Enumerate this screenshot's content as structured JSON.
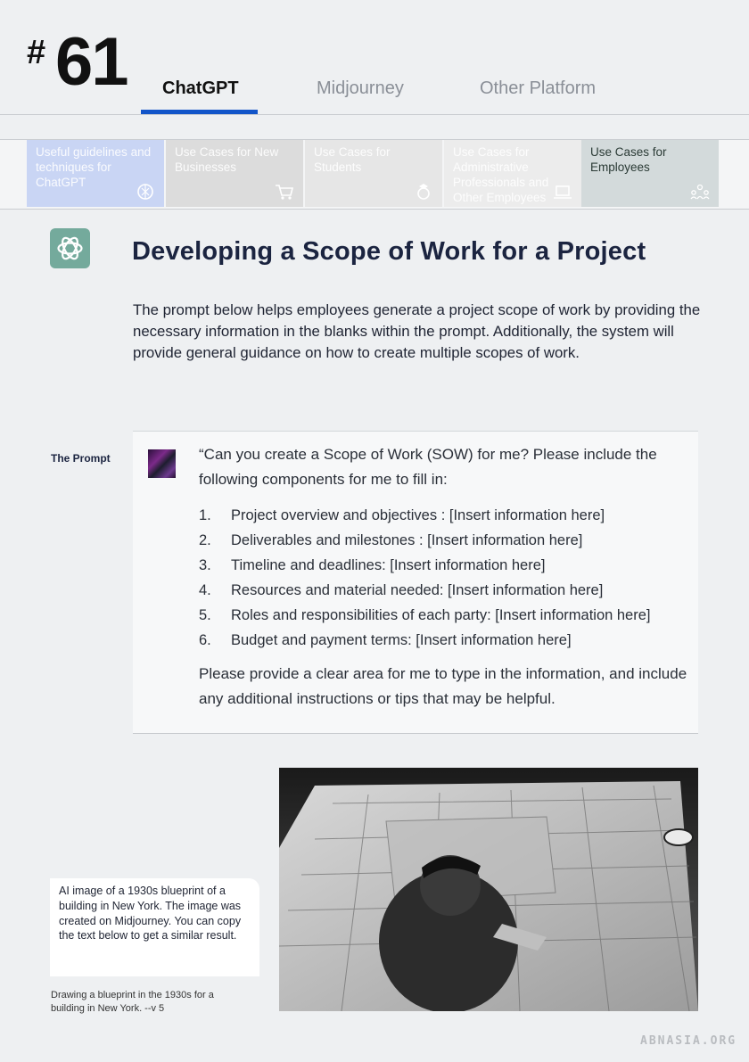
{
  "header": {
    "hash": "#",
    "number": "61",
    "tabs": [
      {
        "label": "ChatGPT",
        "active": true
      },
      {
        "label": "Midjourney",
        "active": false
      },
      {
        "label": "Other Platform",
        "active": false
      }
    ]
  },
  "categories": [
    {
      "label": "Useful guidelines and techniques for ChatGPT",
      "icon": "chatgpt-logo-icon",
      "color": "#c9d5f4"
    },
    {
      "label": "Use Cases for New Businesses",
      "icon": "cart-icon",
      "color": "#dcdcdc"
    },
    {
      "label": "Use Cases for Students",
      "icon": "student-icon",
      "color": "#e6e6e6"
    },
    {
      "label": "Use Cases for Administrative Professionals and Other Employees",
      "icon": "laptop-icon",
      "color": "#ececec"
    },
    {
      "label": "Use Cases for Employees",
      "icon": "team-icon",
      "color": "#d3dadb",
      "active": true
    }
  ],
  "section": {
    "title": "Developing a Scope of Work for a Project",
    "intro": "The prompt below helps employees generate a project scope of work by providing the necessary information in the blanks within the prompt. Additionally, the system will provide general guidance on how to create multiple scopes of work."
  },
  "prompt": {
    "label": "The Prompt",
    "intro": "“Can you create a Scope of Work (SOW) for me? Please include the following components for me to fill in:",
    "items": [
      {
        "n": "1.",
        "text": "Project overview and objectives : [Insert information here]"
      },
      {
        "n": "2.",
        "text": "Deliverables and milestones : [Insert information here]"
      },
      {
        "n": "3.",
        "text": "Timeline and deadlines: [Insert information here]"
      },
      {
        "n": "4.",
        "text": "Resources and material needed: [Insert information here]"
      },
      {
        "n": "5.",
        "text": "Roles and responsibilities of each party: [Insert information here]"
      },
      {
        "n": "6.",
        "text": "Budget and payment terms: [Insert information here]"
      }
    ],
    "outro": "Please provide a clear area for me to type in the information, and include any additional instructions or tips that may be helpful."
  },
  "image_caption": "AI image of a 1930s blueprint of a building in New York. The image was created on Midjourney. You can copy the text below to get a similar result.",
  "midjourney_prompt": "Drawing a blueprint in the 1930s for a building in New York. --v 5",
  "watermark": "ABNASIA.ORG"
}
